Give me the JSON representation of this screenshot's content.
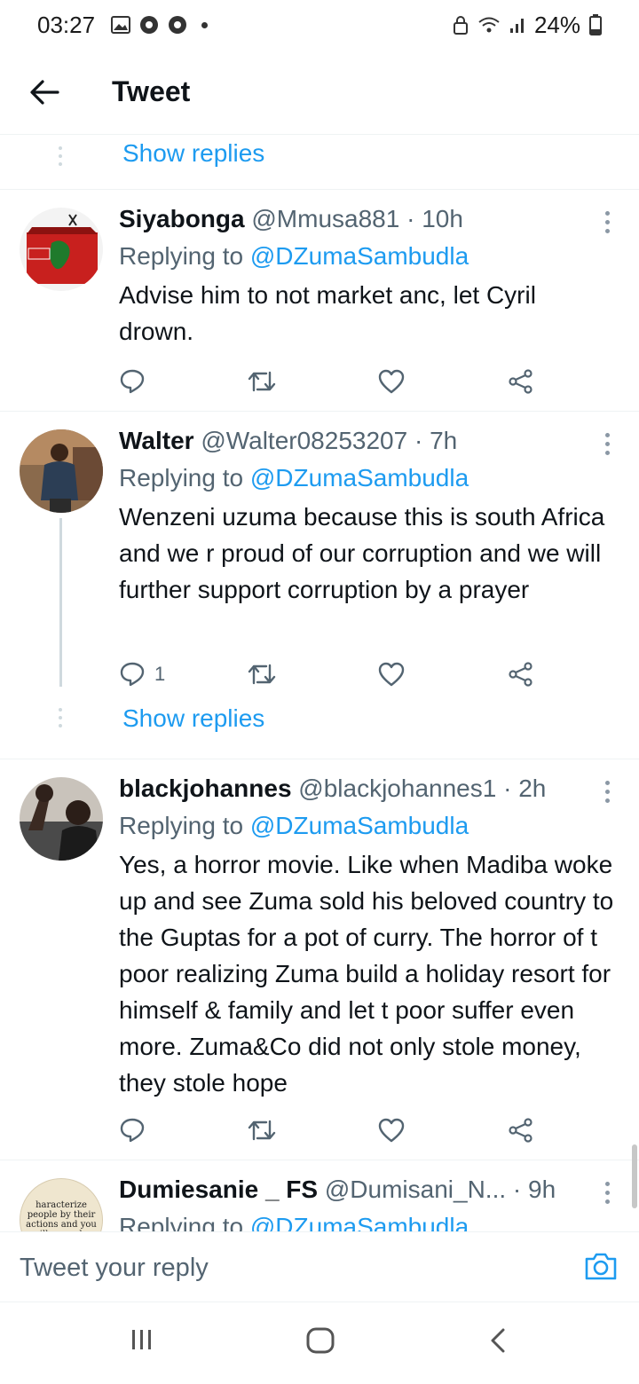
{
  "status_bar": {
    "time": "03:27",
    "battery": "24%"
  },
  "header": {
    "title": "Tweet"
  },
  "top_show_replies": "Show replies",
  "tweets": [
    {
      "name": "Siyabonga",
      "handle": "@Mmusa881",
      "sep": "·",
      "time": "10h",
      "replying_prefix": "Replying to ",
      "replying_to": "@DZumaSambudla",
      "text": "Advise him to not market anc, let Cyril drown.",
      "reply_count": ""
    },
    {
      "name": "Walter",
      "handle": "@Walter08253207",
      "sep": "·",
      "time": "7h",
      "replying_prefix": "Replying to ",
      "replying_to": "@DZumaSambudla",
      "text": "Wenzeni uzuma because this is south Africa and we r proud of our corruption and we will further support corruption by a prayer",
      "reply_count": "1",
      "show_replies": "Show replies"
    },
    {
      "name": "blackjohannes",
      "handle": "@blackjohannes1",
      "sep": "·",
      "time": "2h",
      "replying_prefix": "Replying to ",
      "replying_to": "@DZumaSambudla",
      "text": "Yes, a horror movie. Like when Madiba woke up and see Zuma sold his beloved country to the Guptas for a pot of curry. The horror of t poor realizing Zuma build a holiday resort for himself & family and let t poor suffer even more. Zuma&Co did not only stole money, they stole hope",
      "reply_count": ""
    },
    {
      "name": "Dumiesanie _ FS",
      "handle": "@Dumisani_N...",
      "sep": "·",
      "time": "9h",
      "replying_prefix": "Replying to ",
      "replying_to": "@DZumaSambudla",
      "avatar_text": "haracterize people by their actions and you will never be"
    }
  ],
  "reply_bar": {
    "placeholder": "Tweet your reply"
  },
  "colors": {
    "accent": "#1d9bf0",
    "muted": "#536471",
    "divider": "#eff3f4"
  }
}
